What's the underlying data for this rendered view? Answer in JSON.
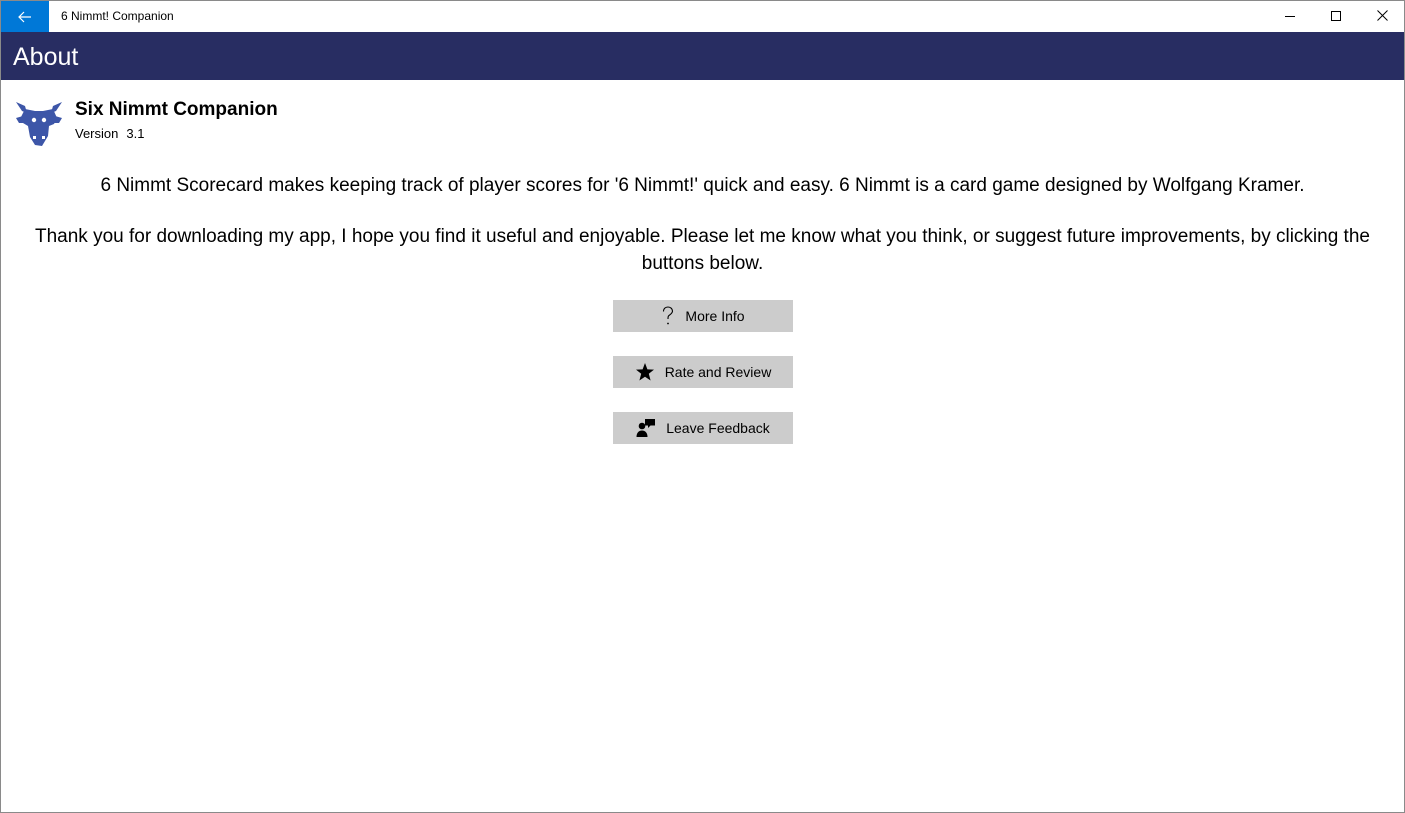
{
  "window": {
    "title": "6 Nimmt! Companion",
    "accent_color": "#0078d7"
  },
  "header": {
    "title": "About",
    "background": "#282d62"
  },
  "app": {
    "name": "Six Nimmt Companion",
    "version_label": "Version",
    "version": "3.1",
    "logo_icon": "bull-head-icon",
    "logo_color": "#3d56a8"
  },
  "content": {
    "description": "6 Nimmt Scorecard makes keeping track of player scores for '6 Nimmt!' quick and easy. 6 Nimmt is a card game designed by Wolfgang Kramer.",
    "thanks": "Thank you for downloading my app, I hope you find it useful and enjoyable. Please let me know what you think, or suggest future improvements, by clicking the buttons below."
  },
  "buttons": {
    "more_info": {
      "label": "More Info",
      "icon": "question-icon"
    },
    "rate_review": {
      "label": "Rate and Review",
      "icon": "star-icon"
    },
    "feedback": {
      "label": "Leave Feedback",
      "icon": "feedback-icon"
    }
  }
}
